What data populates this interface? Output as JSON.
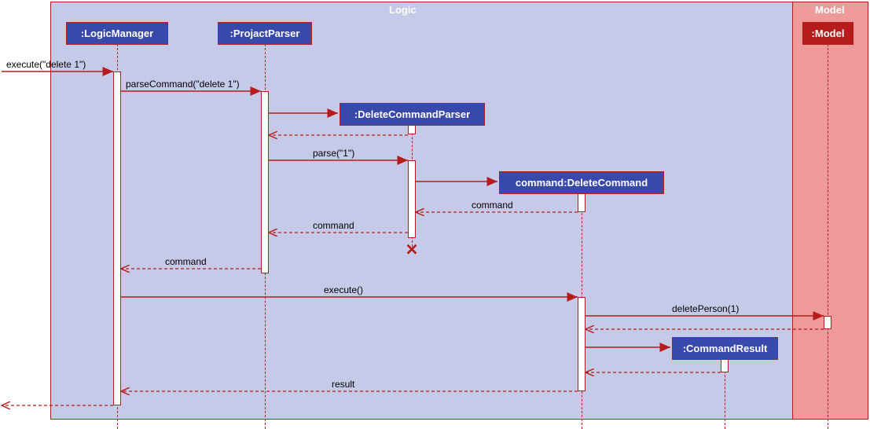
{
  "frames": {
    "logic": "Logic",
    "model": "Model"
  },
  "participants": {
    "logicManager": ":LogicManager",
    "projactParser": ":ProjactParser",
    "deleteCommandParser": ":DeleteCommandParser",
    "deleteCommand": "command:DeleteCommand",
    "commandResult": ":CommandResult",
    "model": ":Model"
  },
  "messages": {
    "execute_delete1": "execute(\"delete 1\")",
    "parseCommand": "parseCommand(\"delete 1\")",
    "parse": "parse(\"1\")",
    "command1": "command",
    "command2": "command",
    "command3": "command",
    "executeCall": "execute()",
    "deletePerson": "deletePerson(1)",
    "result": "result"
  },
  "chart_data": {
    "type": "sequence_diagram",
    "frames": [
      {
        "name": "Logic",
        "contains": [
          "LogicManager",
          "ProjactParser",
          "DeleteCommandParser",
          "DeleteCommand",
          "CommandResult"
        ]
      },
      {
        "name": "Model",
        "contains": [
          "Model"
        ]
      }
    ],
    "participants": [
      {
        "id": "LogicManager",
        "label": ":LogicManager"
      },
      {
        "id": "ProjactParser",
        "label": ":ProjactParser"
      },
      {
        "id": "DeleteCommandParser",
        "label": ":DeleteCommandParser",
        "created_by": "ProjactParser"
      },
      {
        "id": "DeleteCommand",
        "label": "command:DeleteCommand",
        "created_by": "DeleteCommandParser"
      },
      {
        "id": "CommandResult",
        "label": ":CommandResult",
        "created_by": "DeleteCommand"
      },
      {
        "id": "Model",
        "label": ":Model"
      }
    ],
    "messages": [
      {
        "from": "external",
        "to": "LogicManager",
        "label": "execute(\"delete 1\")",
        "type": "call"
      },
      {
        "from": "LogicManager",
        "to": "ProjactParser",
        "label": "parseCommand(\"delete 1\")",
        "type": "call"
      },
      {
        "from": "ProjactParser",
        "to": "DeleteCommandParser",
        "label": "",
        "type": "create"
      },
      {
        "from": "DeleteCommandParser",
        "to": "ProjactParser",
        "label": "",
        "type": "return"
      },
      {
        "from": "ProjactParser",
        "to": "DeleteCommandParser",
        "label": "parse(\"1\")",
        "type": "call"
      },
      {
        "from": "DeleteCommandParser",
        "to": "DeleteCommand",
        "label": "",
        "type": "create"
      },
      {
        "from": "DeleteCommand",
        "to": "DeleteCommandParser",
        "label": "command",
        "type": "return"
      },
      {
        "from": "DeleteCommandParser",
        "to": "ProjactParser",
        "label": "command",
        "type": "return"
      },
      {
        "from": "DeleteCommandParser",
        "to": null,
        "label": "",
        "type": "destroy"
      },
      {
        "from": "ProjactParser",
        "to": "LogicManager",
        "label": "command",
        "type": "return"
      },
      {
        "from": "LogicManager",
        "to": "DeleteCommand",
        "label": "execute()",
        "type": "call"
      },
      {
        "from": "DeleteCommand",
        "to": "Model",
        "label": "deletePerson(1)",
        "type": "call"
      },
      {
        "from": "Model",
        "to": "DeleteCommand",
        "label": "",
        "type": "return"
      },
      {
        "from": "DeleteCommand",
        "to": "CommandResult",
        "label": "",
        "type": "create"
      },
      {
        "from": "CommandResult",
        "to": "DeleteCommand",
        "label": "",
        "type": "return"
      },
      {
        "from": "DeleteCommand",
        "to": "LogicManager",
        "label": "result",
        "type": "return"
      },
      {
        "from": "LogicManager",
        "to": "external",
        "label": "",
        "type": "return"
      }
    ]
  }
}
